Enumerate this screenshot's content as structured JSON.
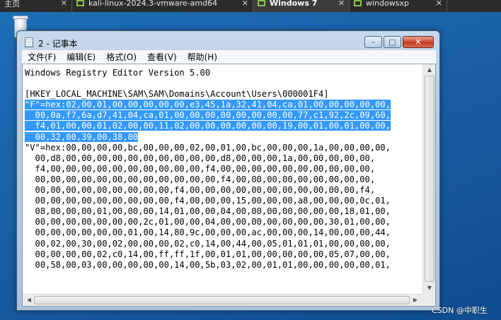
{
  "tabs": [
    {
      "label": "主页",
      "active": false
    },
    {
      "label": "kali-linux-2024.3-vmware-amd64",
      "active": false
    },
    {
      "label": "Windows 7",
      "active": true
    },
    {
      "label": "windowsxp",
      "active": false
    }
  ],
  "window": {
    "title": "2 - 记事本",
    "controls": {
      "minimize": "–",
      "maximize": "□",
      "close": "✕"
    }
  },
  "menu": [
    "文件(F)",
    "编辑(E)",
    "格式(O)",
    "查看(V)",
    "帮助(H)"
  ],
  "editor": {
    "lines": [
      {
        "text": "Windows Registry Editor Version 5.00",
        "selected": false
      },
      {
        "text": "",
        "selected": false
      },
      {
        "text": "[HKEY_LOCAL_MACHINE\\SAM\\SAM\\Domains\\Account\\Users\\000001F4]",
        "selected": false
      },
      {
        "text": "\"F\"=hex:02,00,01,00,00,00,00,00,e3,45,1a,32,41,04,ca,01,00,00,00,00,00,",
        "selected": true
      },
      {
        "text": "  00,0a,f7,6a,d7,41,04,ca,01,00,00,00,00,00,00,00,00,77,c1,92,2c,09,60,",
        "selected": true
      },
      {
        "text": "  f4,01,00,00,01,02,00,00,11,02,00,00,00,00,00,00,19,00,01,00,01,00,00,",
        "selected": true
      },
      {
        "text": "  00,32,00,39,00,38,00",
        "selected": true
      },
      {
        "text": "\"V\"=hex:00,00,00,00,bc,00,00,00,02,00,01,00,bc,00,00,00,1a,00,00,00,00,",
        "selected": false
      },
      {
        "text": "  00,d8,00,00,00,00,00,00,00,00,00,00,d8,00,00,00,1a,00,00,00,00,00,",
        "selected": false
      },
      {
        "text": "  f4,00,00,00,00,00,00,00,00,00,00,f4,00,00,00,00,00,00,00,00,00,00,",
        "selected": false
      },
      {
        "text": "  00,00,00,00,00,00,00,00,00,00,00,00,f4,00,00,00,00,00,00,00,00,00,",
        "selected": false
      },
      {
        "text": "  00,00,00,00,00,00,00,00,00,f4,00,00,00,00,00,00,00,00,00,00,00,f4,",
        "selected": false
      },
      {
        "text": "  00,00,00,00,00,00,00,00,00,f4,00,00,00,15,00,00,00,a8,00,00,00,0c,01,",
        "selected": false
      },
      {
        "text": "  08,00,00,00,01,00,00,00,14,01,00,00,04,00,00,00,00,00,00,00,18,01,00,",
        "selected": false
      },
      {
        "text": "  00,00,00,00,00,00,00,2c,01,00,00,04,00,00,00,00,00,00,00,30,01,00,00,",
        "selected": false
      },
      {
        "text": "  00,00,00,00,00,00,01,00,14,80,9c,00,00,00,ac,00,00,00,14,00,00,00,44,",
        "selected": false
      },
      {
        "text": "  00,02,00,30,00,02,00,00,00,02,c0,14,00,44,00,05,01,01,01,00,00,00,00,",
        "selected": false
      },
      {
        "text": "  00,00,00,00,02,c0,14,00,ff,ff,1f,00,01,01,00,00,00,00,00,05,07,00,00,",
        "selected": false
      },
      {
        "text": "  00,58,00,03,00,00,00,00,00,14,00,5b,03,02,00,01,01,00,00,00,00,00,01,",
        "selected": false
      }
    ]
  },
  "watermark": "CSDN @中职生"
}
